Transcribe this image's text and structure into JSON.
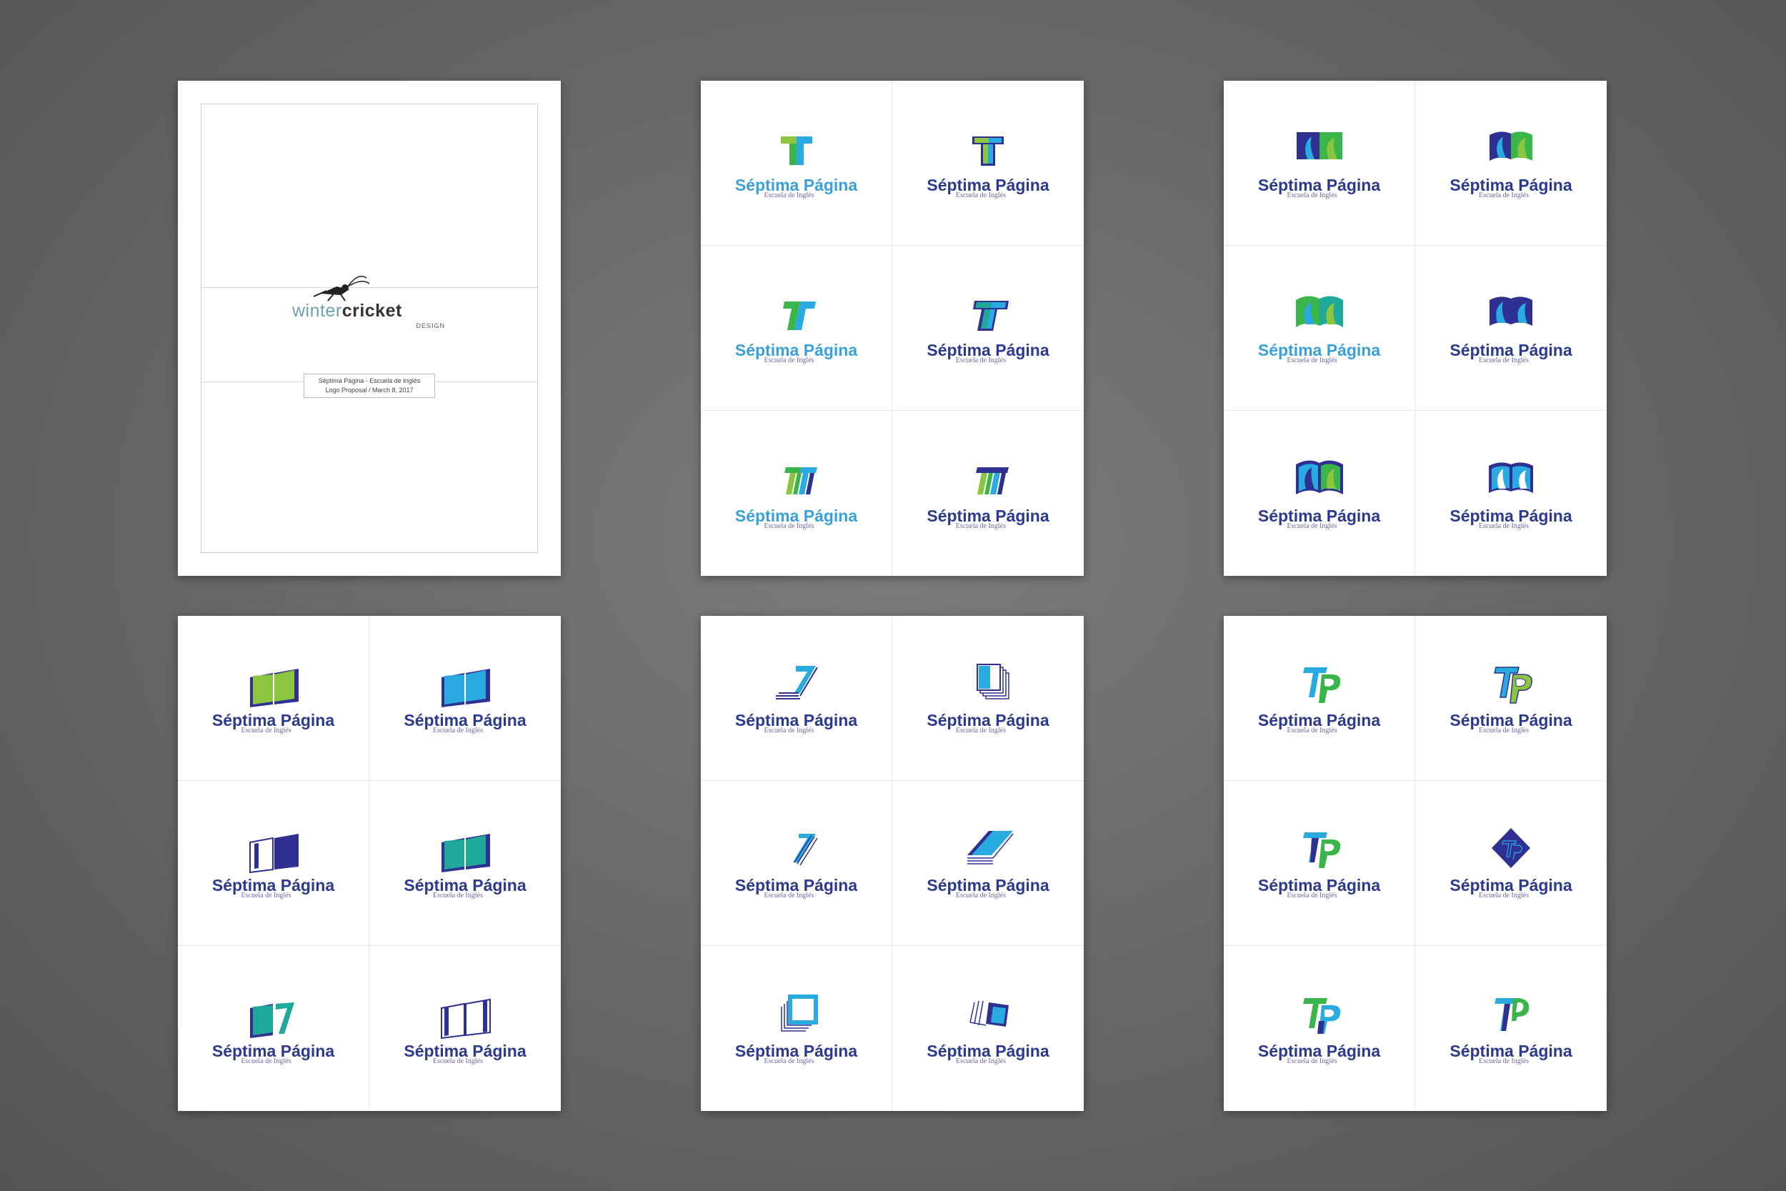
{
  "cover": {
    "brand_light": "winter",
    "brand_bold": "cricket",
    "brand_sub": "DESIGN",
    "caption_line1": "Séptima Página - Escuela de Inglés",
    "caption_line2": "Logo Proposal / March 8, 2017"
  },
  "logo": {
    "name": "Séptima Página",
    "tagline": "Escuela de Inglés"
  },
  "colors": {
    "light_green": "#8cc63f",
    "green": "#39b54a",
    "teal": "#1fa99a",
    "light_blue": "#29abe2",
    "dark_blue": "#2e3192"
  },
  "sheets": [
    {
      "concept": "t-letter",
      "variants": [
        "green-blue-t",
        "blue-green-t",
        "italic-green-t",
        "italic-blue-t",
        "striped-t-a",
        "striped-t-b"
      ]
    },
    {
      "concept": "wave-book",
      "variants": [
        "wave-book-blue-green",
        "wave-book-curved",
        "wave-book-green",
        "wave-book-blue",
        "wave-book-outline-green",
        "wave-book-outline-blue"
      ]
    },
    {
      "concept": "open-book",
      "variants": [
        "book-green",
        "book-light-blue",
        "book-outline",
        "book-teal",
        "book-teal-seven",
        "book-outline-light"
      ]
    },
    {
      "concept": "seven-pages",
      "variants": [
        "seven-stack",
        "page-stack-square",
        "seven-italic",
        "stacked-slab",
        "hollow-page",
        "tilted-square"
      ]
    },
    {
      "concept": "tp-monogram",
      "variants": [
        "tp-blue-green",
        "tp-blue-outline",
        "tp-green-blue",
        "tp-diamond",
        "tp-green",
        "tp-light-blue"
      ]
    }
  ]
}
